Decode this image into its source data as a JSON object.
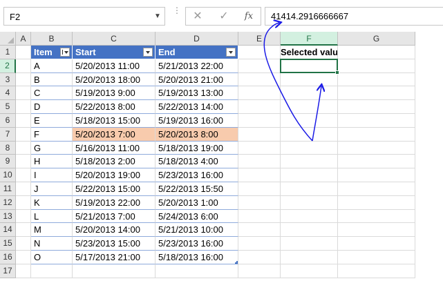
{
  "formula_bar": {
    "name_box": "F2",
    "formula": "41414.2916666667",
    "cancel_symbol": "✕",
    "enter_symbol": "✓",
    "fx_label": "fx"
  },
  "columns": [
    "A",
    "B",
    "C",
    "D",
    "E",
    "F",
    "G"
  ],
  "rows": [
    "1",
    "2",
    "3",
    "4",
    "5",
    "6",
    "7",
    "8",
    "9",
    "10",
    "11",
    "12",
    "13",
    "14",
    "15",
    "16",
    "17"
  ],
  "table": {
    "headers": [
      "Item",
      "Start",
      "End"
    ],
    "rows": [
      [
        "A",
        "5/20/2013 11:00",
        "5/21/2013 22:00"
      ],
      [
        "B",
        "5/20/2013 18:00",
        "5/20/2013 21:00"
      ],
      [
        "C",
        "5/19/2013 9:00",
        "5/19/2013 13:00"
      ],
      [
        "D",
        "5/22/2013 8:00",
        "5/22/2013 14:00"
      ],
      [
        "E",
        "5/18/2013 15:00",
        "5/19/2013 16:00"
      ],
      [
        "F",
        "5/20/2013 7:00",
        "5/20/2013 8:00"
      ],
      [
        "G",
        "5/16/2013 11:00",
        "5/18/2013 19:00"
      ],
      [
        "H",
        "5/18/2013 2:00",
        "5/18/2013 4:00"
      ],
      [
        "I",
        "5/20/2013 19:00",
        "5/23/2013 16:00"
      ],
      [
        "J",
        "5/22/2013 15:00",
        "5/22/2013 15:50"
      ],
      [
        "K",
        "5/19/2013 22:00",
        "5/20/2013 1:00"
      ],
      [
        "L",
        "5/21/2013 7:00",
        "5/24/2013 6:00"
      ],
      [
        "M",
        "5/20/2013 14:00",
        "5/21/2013 10:00"
      ],
      [
        "N",
        "5/23/2013 15:00",
        "5/23/2013 16:00"
      ],
      [
        "O",
        "5/17/2013 21:00",
        "5/18/2013 16:00"
      ]
    ],
    "highlight_row": 5,
    "header_color": "#4472c4",
    "highlight_color": "#f8cbad"
  },
  "selected_values_title": "Selected values",
  "selected_cell": "F2",
  "accent_color": "#217346",
  "annotation_color": "#1a1ae6"
}
